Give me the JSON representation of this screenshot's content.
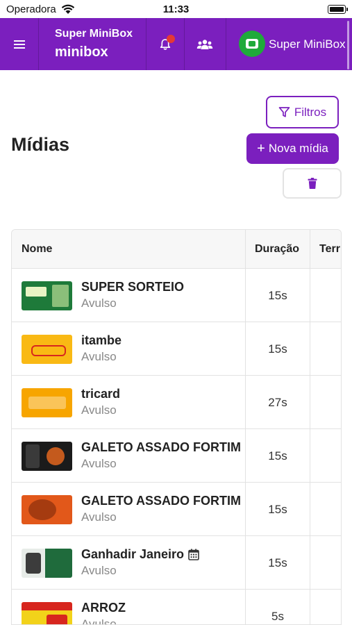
{
  "status_bar": {
    "carrier": "Operadora",
    "time": "11:33"
  },
  "header": {
    "title": "Super MiniBox",
    "subtitle": "minibox",
    "account_name": "Super MiniBox"
  },
  "page": {
    "title": "Mídias",
    "filters_label": "Filtros",
    "new_media_label": "Nova mídia",
    "new_media_plus": "+"
  },
  "table": {
    "columns": [
      "Nome",
      "Duração",
      "Terr"
    ],
    "rows": [
      {
        "name": "SUPER SORTEIO",
        "type": "Avulso",
        "duration": "15s"
      },
      {
        "name": "itambe",
        "type": "Avulso",
        "duration": "15s"
      },
      {
        "name": "tricard",
        "type": "Avulso",
        "duration": "27s"
      },
      {
        "name": "GALETO ASSADO FORTIM",
        "type": "Avulso",
        "duration": "15s"
      },
      {
        "name": "GALETO ASSADO FORTIM",
        "type": "Avulso",
        "duration": "15s"
      },
      {
        "name": "Ganhadir Janeiro",
        "type": "Avulso",
        "duration": "15s"
      },
      {
        "name": "ARROZ",
        "type": "Avulso",
        "duration": "5s"
      }
    ]
  },
  "colors": {
    "brand": "#7b1fbe",
    "notification": "#e53935",
    "avatar": "#1faa3a"
  },
  "icons": [
    "wifi-icon",
    "battery-icon",
    "hamburger-icon",
    "bell-icon",
    "users-icon",
    "filter-icon",
    "plus-icon",
    "trash-icon",
    "calendar-icon"
  ]
}
